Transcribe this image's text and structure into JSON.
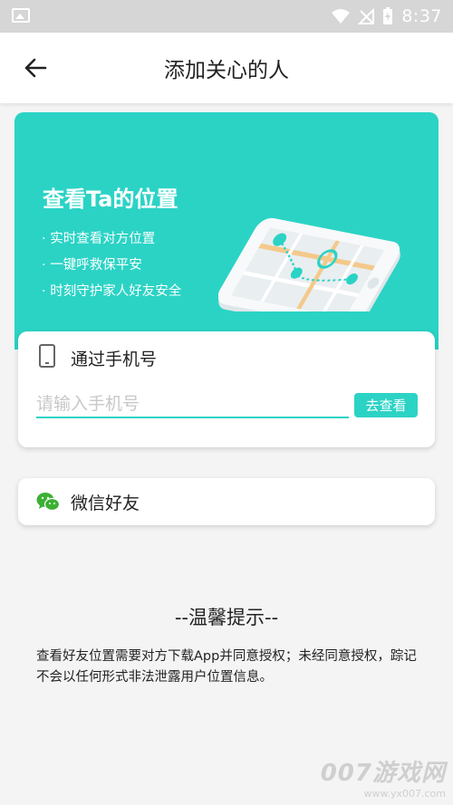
{
  "status_bar": {
    "time": "8:37"
  },
  "header": {
    "title": "添加关心的人"
  },
  "banner": {
    "headline": "查看Ta的位置",
    "features": [
      "· 实时查看对方位置",
      "· 一键呼救保平安",
      "· 时刻守护家人好友安全"
    ]
  },
  "phone_card": {
    "title": "通过手机号",
    "input_placeholder": "请输入手机号",
    "input_value": "",
    "button_label": "去查看"
  },
  "wechat_card": {
    "title": "微信好友"
  },
  "tips": {
    "title": "--温馨提示--",
    "text": "查看好友位置需要对方下载App并同意授权；未经同意授权，踪记不会以任何形式非法泄露用户位置信息。"
  },
  "watermark": {
    "title": "007游戏网",
    "url": "www.yx007.com"
  },
  "colors": {
    "accent": "#2bd3c5",
    "wechat": "#3cb034"
  }
}
